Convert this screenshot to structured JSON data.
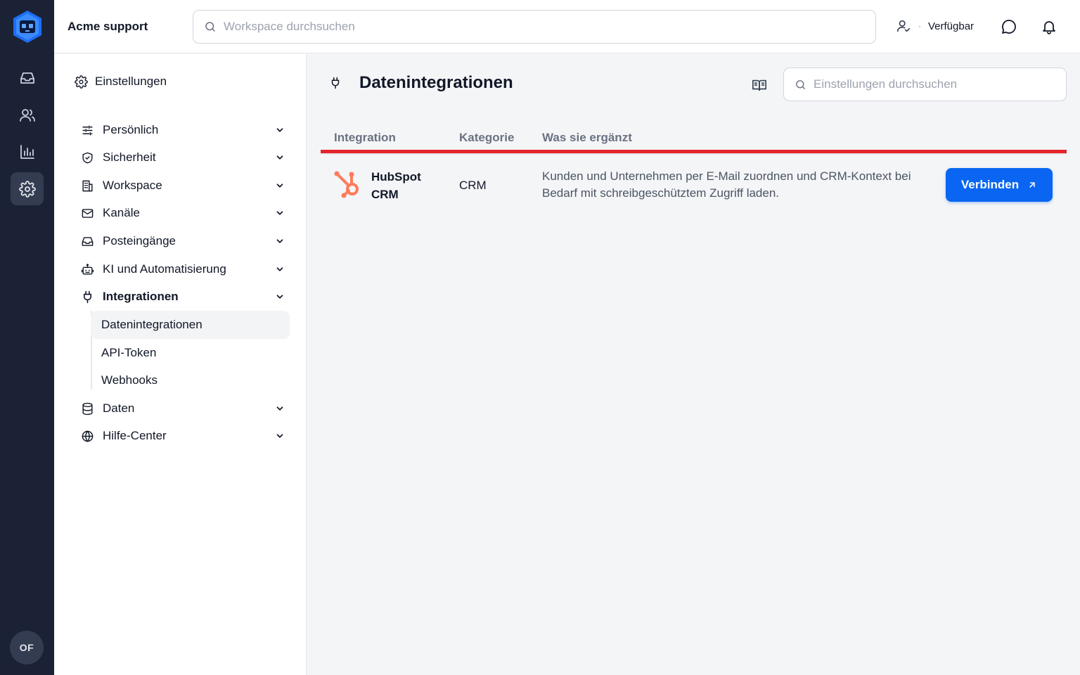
{
  "topbar": {
    "workspace_name": "Acme support",
    "search_placeholder": "Workspace durchsuchen",
    "status_label": "Verfügbar",
    "status_separator": "·"
  },
  "rail": {
    "avatar_initials": "OF",
    "items": [
      {
        "icon": "inbox-icon"
      },
      {
        "icon": "users-icon"
      },
      {
        "icon": "chart-icon"
      },
      {
        "icon": "gear-icon",
        "active": true
      }
    ]
  },
  "settings": {
    "heading": "Einstellungen",
    "nav": [
      {
        "label": "Persönlich",
        "icon": "sliders-icon"
      },
      {
        "label": "Sicherheit",
        "icon": "shield-icon"
      },
      {
        "label": "Workspace",
        "icon": "building-icon"
      },
      {
        "label": "Kanäle",
        "icon": "mail-icon"
      },
      {
        "label": "Posteingänge",
        "icon": "inbox-icon"
      },
      {
        "label": "KI und Automatisierung",
        "icon": "robot-icon"
      },
      {
        "label": "Integrationen",
        "icon": "plug-icon",
        "expanded": true
      },
      {
        "label": "Daten",
        "icon": "database-icon"
      },
      {
        "label": "Hilfe-Center",
        "icon": "globe-icon"
      }
    ],
    "sub_items": [
      {
        "label": "Datenintegrationen",
        "active": true
      },
      {
        "label": "API-Token"
      },
      {
        "label": "Webhooks"
      }
    ]
  },
  "main": {
    "title": "Datenintegrationen",
    "search_placeholder": "Einstellungen durchsuchen",
    "columns": {
      "integration": "Integration",
      "category": "Kategorie",
      "description": "Was sie ergänzt"
    },
    "rows": [
      {
        "name": "HubSpot CRM",
        "category": "CRM",
        "description": "Kunden und Unternehmen per E-Mail zuordnen und CRM-Kontext bei Bedarf mit schreibgeschütztem Zugriff laden.",
        "action": "Verbinden"
      }
    ]
  },
  "colors": {
    "rail_bg": "#1b2236",
    "accent": "#0a66f2",
    "highlight_line": "#e5242b",
    "hubspot": "#ff7a59"
  }
}
